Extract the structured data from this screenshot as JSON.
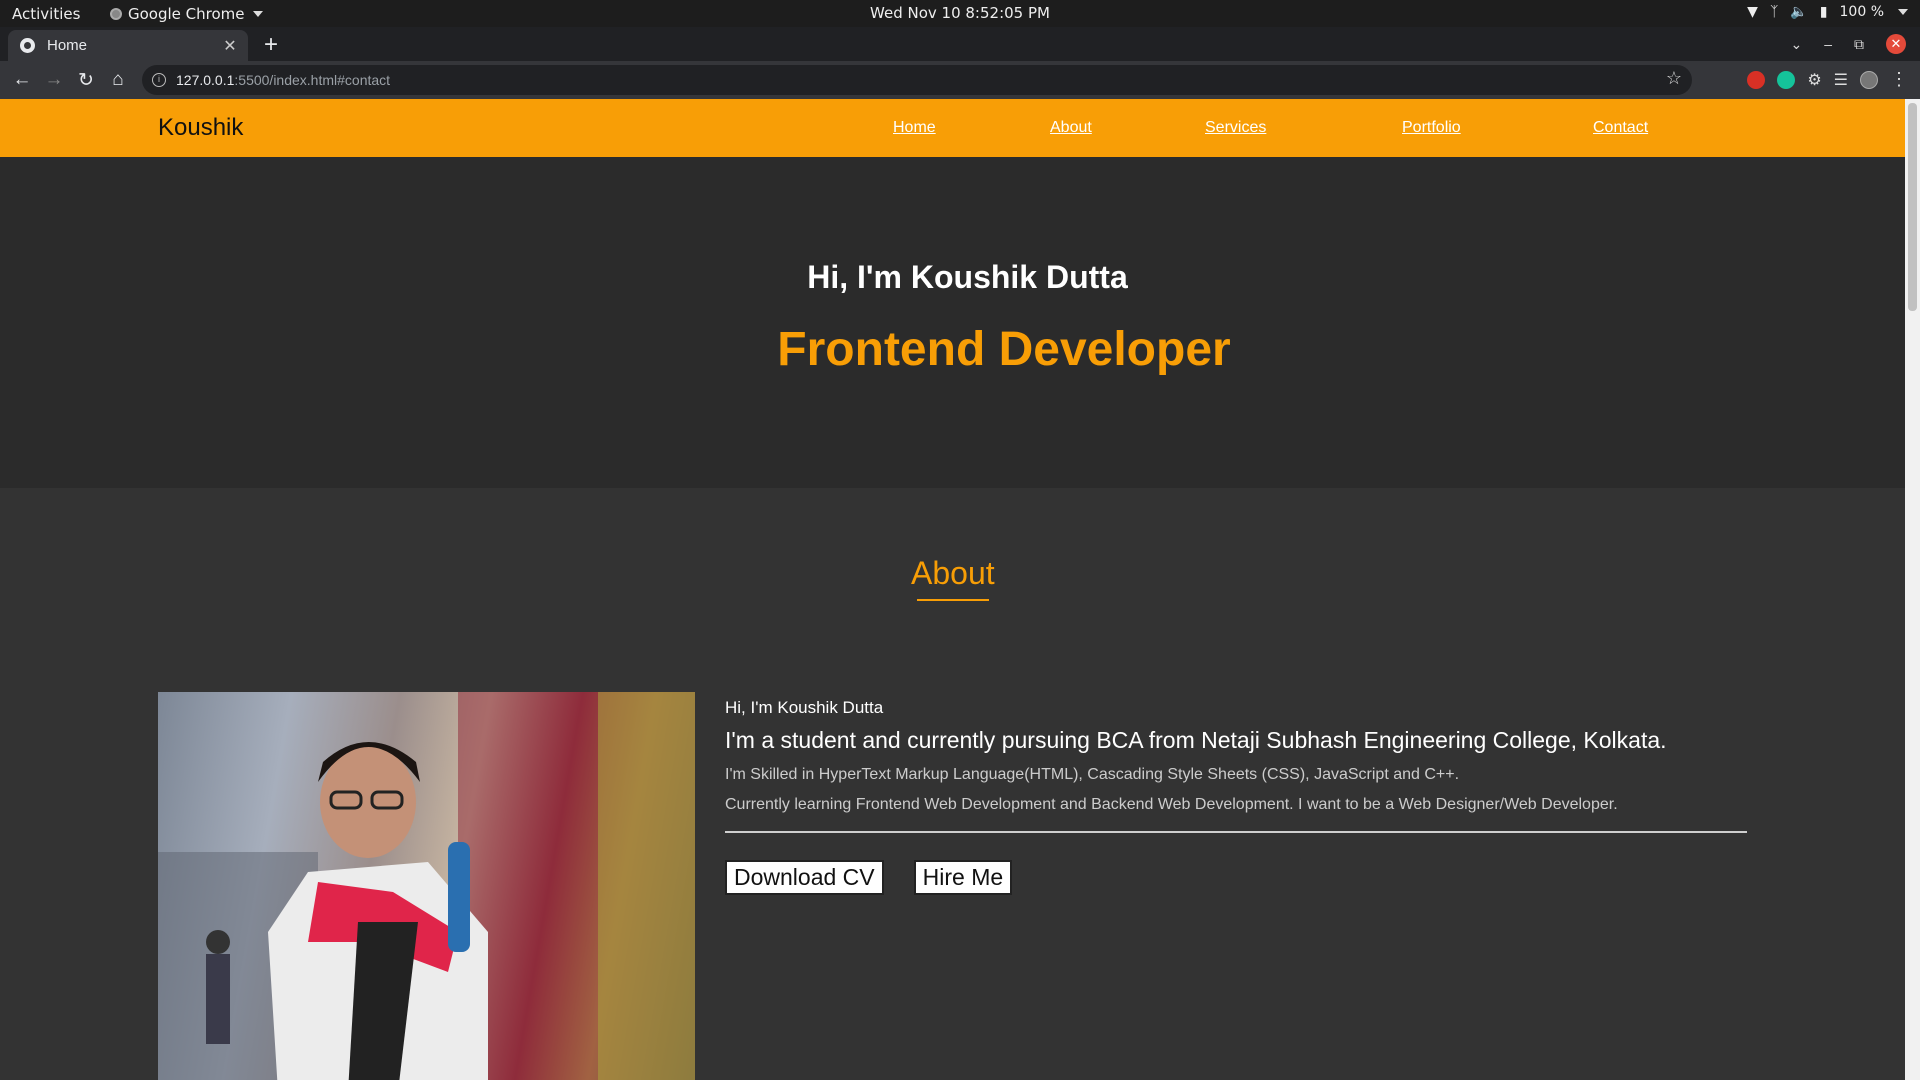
{
  "system": {
    "activities": "Activities",
    "app_name": "Google Chrome",
    "clock": "Wed Nov 10  8:52:05 PM",
    "battery": "100 %"
  },
  "browser": {
    "tab_title": "Home",
    "url_host": "127.0.0.1",
    "url_rest": ":5500/index.html#contact"
  },
  "site": {
    "brand": "Koushik",
    "nav": [
      "Home",
      "About",
      "Services",
      "Portfolio",
      "Contact"
    ],
    "hero_greeting": "Hi, I'm Koushik Dutta",
    "hero_role": "Frontend Developer",
    "about_title": "About",
    "about_intro": "Hi, I'm Koushik Dutta",
    "about_headline": "I'm a student and currently pursuing BCA from Netaji Subhash Engineering College, Kolkata.",
    "about_skills": "I'm Skilled in HyperText Markup Language(HTML), Cascading Style Sheets (CSS), JavaScript and C++.",
    "about_learning": "Currently learning Frontend Web Development and Backend Web Development. I want to be a Web Designer/Web Developer.",
    "download_cv": "Download CV",
    "hire_me": "Hire Me"
  },
  "colors": {
    "accent": "#f89e06",
    "page_bg": "#2b2b2b",
    "about_bg": "#333333"
  }
}
